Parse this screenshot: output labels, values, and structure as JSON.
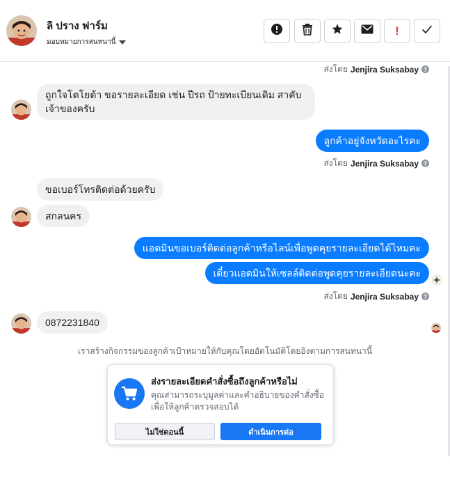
{
  "header": {
    "contact_name": "ลิ ปราง ฟาร์ม",
    "assign_label": "มอบหมายการสนทนานี้",
    "tools": [
      {
        "icon": "alert-circle-icon"
      },
      {
        "icon": "trash-icon"
      },
      {
        "icon": "star-icon"
      },
      {
        "icon": "mail-icon"
      },
      {
        "icon": "exclamation-icon",
        "label": "!",
        "color": "#fa383e"
      },
      {
        "icon": "check-icon"
      }
    ]
  },
  "sent_by": {
    "prefix": "ส่งโดย",
    "agent": "Jenjira Suksabay",
    "help": "?"
  },
  "messages": {
    "in_1": "ถูกใจโตโยต้า ขอรายละเอียด เช่น ปีรถ ป้ายทะเบียนเดิม สาคับเจ้าของครับ",
    "out_1": "ลูกค้าอยู่จังหวัดอะไรคะ",
    "in_2a": "ขอเบอร์โทรติดต่อด้วยครับ",
    "in_2b": "สกลนคร",
    "out_2a": "แอดมินขอเบอร์ติดต่อลูกค้าหรือไลน์เพื่อพูดคุยรายละเอียดได้ไหมคะ",
    "out_2b": "เดี๋ยวแอดมินให้เซลล์ติดต่อพูดคุยรายละเอียดนะคะ",
    "in_3": "0872231840"
  },
  "system_note": "เราสร้างกิจกรรมของลูกค้าเป้าหมายให้กับคุณโดยอัตโนมัติโดยอิงตามการสนทนานี้",
  "card": {
    "title": "ส่งรายละเอียดคำสั่งซื้อถึงลูกค้าหรือไม่",
    "description": "คุณสามารถระบุมูลค่าและคำอธิบายของคำสั่งซื้อเพื่อให้ลูกค้าตรวจสอบได้",
    "secondary_button": "ไม่ใช่ตอนนี้",
    "primary_button": "ดำเนินการต่อ"
  },
  "colors": {
    "accent": "#1877f2",
    "outgoing_bubble": "#0a7cff",
    "incoming_bubble": "#f0f0f0"
  }
}
